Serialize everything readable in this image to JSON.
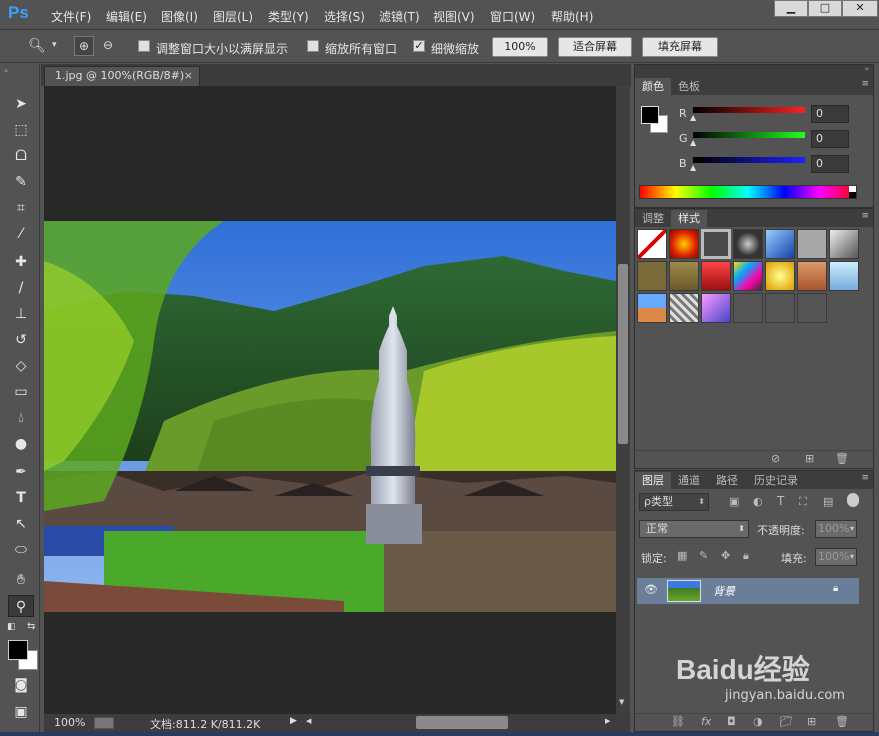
{
  "app": {
    "logo": "Ps"
  },
  "menu": [
    "文件(F)",
    "编辑(E)",
    "图像(I)",
    "图层(L)",
    "类型(Y)",
    "选择(S)",
    "滤镜(T)",
    "视图(V)",
    "窗口(W)",
    "帮助(H)"
  ],
  "window_controls": {
    "minimize": "▁",
    "restore": "□",
    "close": "✕"
  },
  "options": {
    "resize_windows_label": "调整窗口大小以满屏显示",
    "zoom_all_label": "缩放所有窗口",
    "scrubby_zoom_label": "细微缩放",
    "zoom_100_button": "100%",
    "fit_screen_button": "适合屏幕",
    "fill_screen_button": "填充屏幕",
    "scrubby_zoom_checked": true
  },
  "document": {
    "tab_title": "1.jpg @ 100%(RGB/8#)",
    "close": "×"
  },
  "status": {
    "zoom": "100%",
    "doc_info": "文档:811.2 K/811.2K"
  },
  "color_panel": {
    "tabs": [
      "颜色",
      "色板"
    ],
    "channels": [
      {
        "label": "R",
        "value": "0",
        "color": "#ff2020"
      },
      {
        "label": "G",
        "value": "0",
        "color": "#20ff20"
      },
      {
        "label": "B",
        "value": "0",
        "color": "#2020ff"
      }
    ]
  },
  "styles_panel": {
    "tabs": [
      "调整",
      "样式"
    ]
  },
  "layers_panel": {
    "tabs": [
      "图层",
      "通道",
      "路径",
      "历史记录"
    ],
    "filter_label": "ρ类型",
    "blend_mode": "正常",
    "opacity_label": "不透明度:",
    "opacity_value": "100%",
    "lock_label": "锁定:",
    "fill_label": "填充:",
    "fill_value": "100%",
    "layer_name": "背景"
  },
  "watermark": {
    "brand": "Baidu经验",
    "url": "jingyan.baidu.com"
  }
}
